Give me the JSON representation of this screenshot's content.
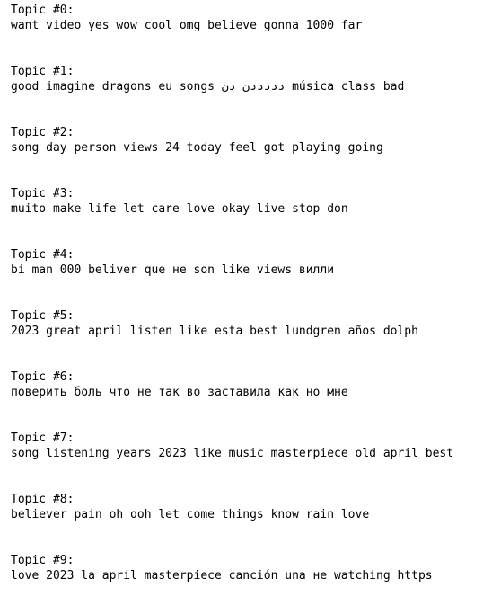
{
  "topics": [
    {
      "heading": "Topic #0:",
      "words": "want video yes wow cool omg believe gonna 1000 far"
    },
    {
      "heading": "Topic #1:",
      "words": "good imagine dragons eu songs دددددن دن música class bad"
    },
    {
      "heading": "Topic #2:",
      "words": "song day person views 24 today feel got playing going"
    },
    {
      "heading": "Topic #3:",
      "words": "muito make life let care love okay live stop don"
    },
    {
      "heading": "Topic #4:",
      "words": "bi man 000 beliver que не son like views вилли"
    },
    {
      "heading": "Topic #5:",
      "words": "2023 great april listen like esta best lundgren años dolph"
    },
    {
      "heading": "Topic #6:",
      "words": "поверить боль что не так во заставила как но мне"
    },
    {
      "heading": "Topic #7:",
      "words": "song listening years 2023 like music masterpiece old april best"
    },
    {
      "heading": "Topic #8:",
      "words": "believer pain oh ooh let come things know rain love"
    },
    {
      "heading": "Topic #9:",
      "words": "love 2023 la april masterpiece canción una не watching https"
    }
  ]
}
